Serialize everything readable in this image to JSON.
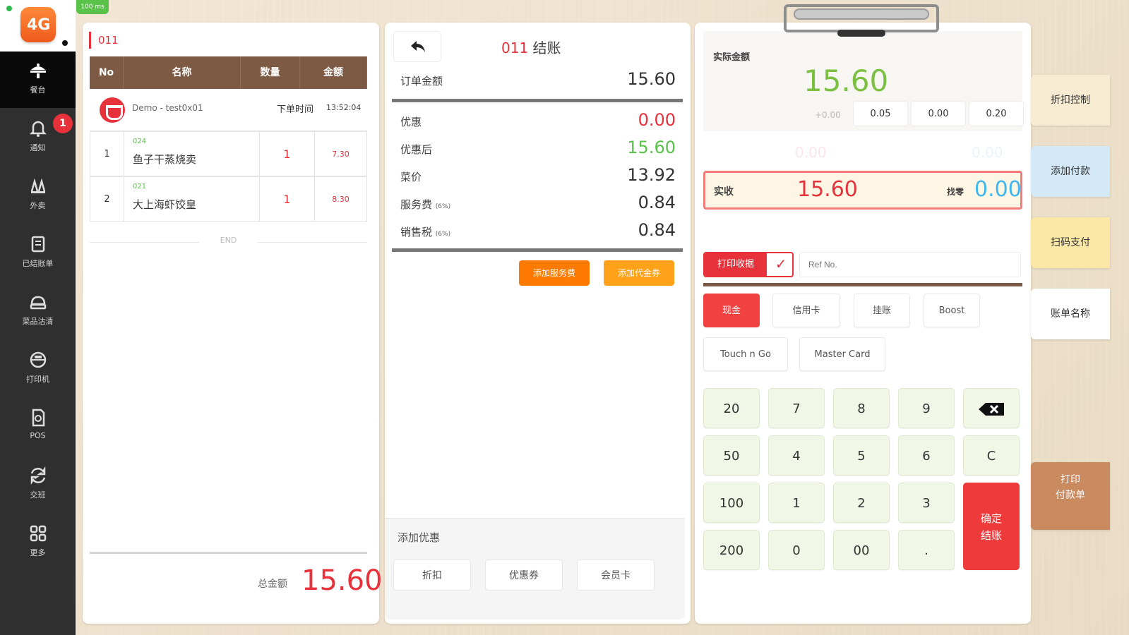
{
  "app": {
    "logo_text": "4G",
    "status_label": "100 ms"
  },
  "sidebar": {
    "badge_count": "1",
    "items": [
      {
        "label": "餐台",
        "icon": "table-service-icon",
        "active": true
      },
      {
        "label": "通知",
        "icon": "notification-bell-icon"
      },
      {
        "label": "外卖",
        "icon": "takeaway-icon"
      },
      {
        "label": "已结账单",
        "icon": "closed-bills-icon"
      },
      {
        "label": "菜品沽清",
        "icon": "sold-out-icon"
      },
      {
        "label": "打印机",
        "icon": "printer-icon"
      },
      {
        "label": "POS",
        "icon": "pos-icon"
      },
      {
        "label": "交班",
        "icon": "shift-handover-icon"
      },
      {
        "label": "更多",
        "icon": "more-grid-icon"
      }
    ]
  },
  "order": {
    "tag": "011",
    "columns": [
      "No",
      "名称",
      "数量",
      "金额"
    ],
    "customer": "Demo - test0x01",
    "time_label": "下单时间",
    "time": "13:52:04",
    "items": [
      {
        "no": "1",
        "code": "024",
        "name": "鱼子干蒸烧卖",
        "qty": "1",
        "amount": "7.30"
      },
      {
        "no": "2",
        "code": "021",
        "name": "大上海虾饺皇",
        "qty": "1",
        "amount": "8.30"
      }
    ],
    "end_label": "END",
    "total_label": "总金额",
    "total": "15.60"
  },
  "checkout": {
    "table": "011",
    "title": "结账",
    "rows": [
      {
        "label": "订单金额",
        "note": "",
        "value": "15.60",
        "color": "#333333"
      },
      {
        "label": "优惠",
        "note": "",
        "value": "0.00",
        "color": "#e8323b"
      },
      {
        "label": "优惠后",
        "note": "",
        "value": "15.60",
        "color": "#5ac24a"
      },
      {
        "label": "菜价",
        "note": "",
        "value": "13.92",
        "color": "#333333"
      },
      {
        "label": "服务费",
        "note": "(6%)",
        "value": "0.84",
        "color": "#333333"
      },
      {
        "label": "销售税",
        "note": "(6%)",
        "value": "0.84",
        "color": "#333333"
      }
    ],
    "btn_add_service": "添加服务费",
    "btn_add_tax": "添加代金券",
    "discount_title": "添加优惠",
    "discount_buttons": [
      "折扣",
      "优惠券",
      "会员卡"
    ]
  },
  "payment": {
    "due_label": "实际金额",
    "due_value": "15.60",
    "adjust": "+0.00",
    "quick_chips": [
      "0.05",
      "0.00",
      "0.20"
    ],
    "faded_left": "0.00",
    "faded_right": "0.00",
    "received_label": "实收",
    "received_value": "15.60",
    "change_label": "找零",
    "change_value": "0.00",
    "print_label": "打印收据",
    "ref_placeholder": "Ref No.",
    "methods": [
      "现金",
      "信用卡",
      "挂账",
      "Boost",
      "Touch n Go",
      "Master Card"
    ],
    "keypad": {
      "r1": [
        "20",
        "7",
        "8",
        "9"
      ],
      "r2": [
        "50",
        "4",
        "5",
        "6",
        "C"
      ],
      "r3": [
        "100",
        "1",
        "2",
        "3"
      ],
      "r4": [
        "200",
        "0",
        "00",
        "."
      ],
      "confirm": "确定\n结账"
    }
  },
  "side_actions": {
    "b1": "折扣控制",
    "b2": "添加付款",
    "b3": "扫码支付",
    "b4": "账单名称",
    "b5_line1": "打印",
    "b5_line2": "付款单"
  }
}
